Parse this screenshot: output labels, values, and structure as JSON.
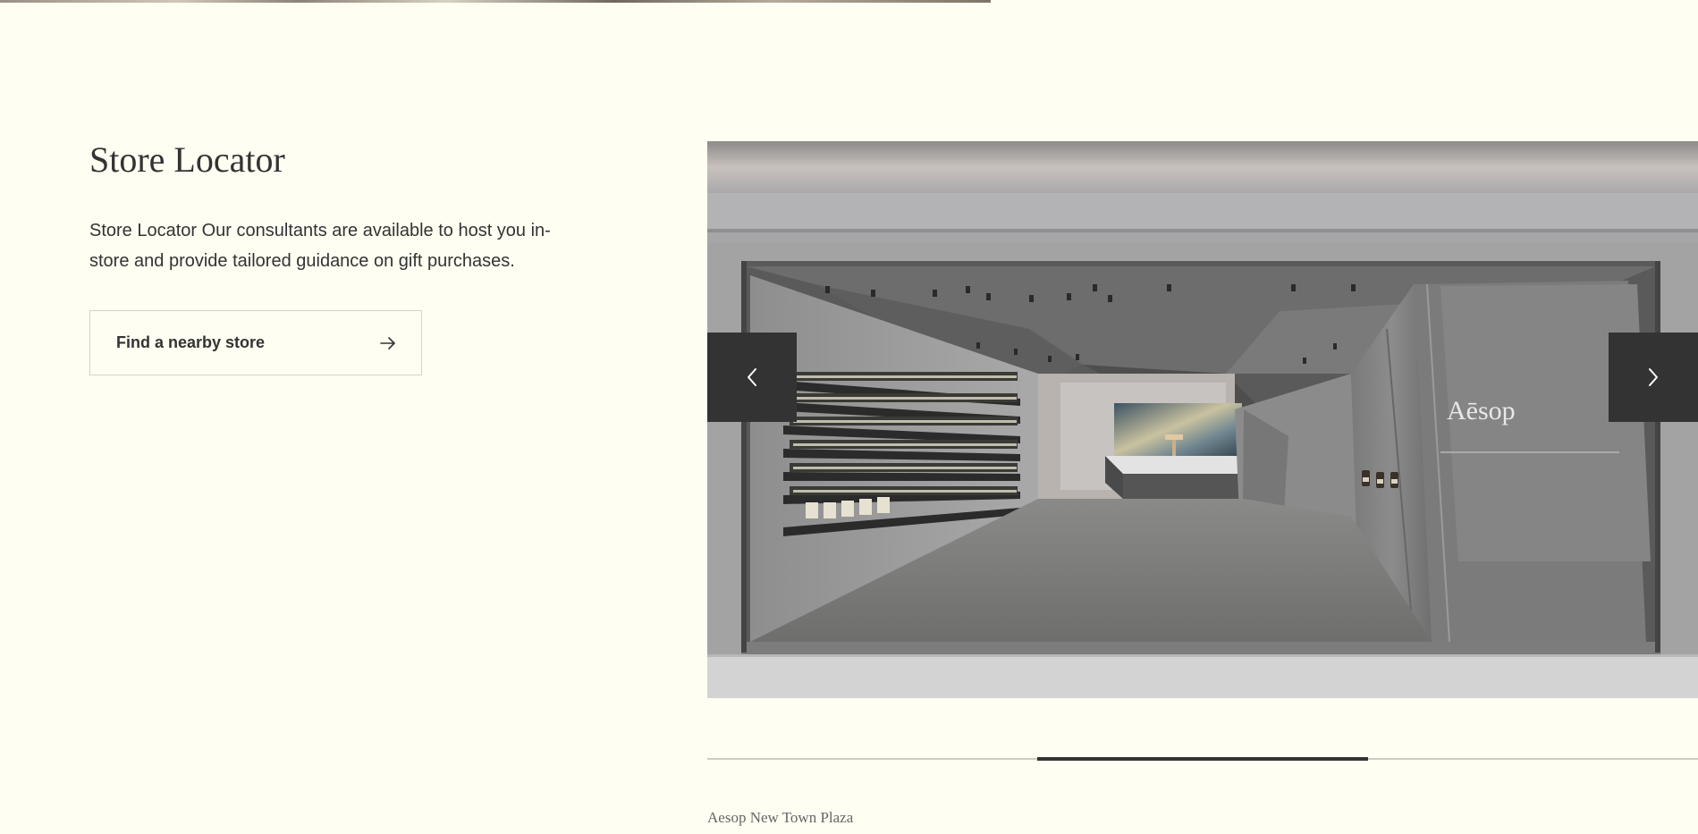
{
  "section": {
    "title": "Store Locator",
    "description": "Store Locator Our consultants are available to host you in-store and provide tailored guidance on gift purchases.",
    "cta_label": "Find a nearby store",
    "cta_icon": "arrow-right-icon"
  },
  "carousel": {
    "slide_brand_text": "Aēsop",
    "caption": "Aesop New Town Plaza",
    "prev_icon": "chevron-left-icon",
    "next_icon": "chevron-right-icon",
    "current_slide": 2,
    "total_slides": 3
  },
  "colors": {
    "page_background": "#fffef2",
    "text": "#333333",
    "button_dark": "#333333",
    "caption_text": "#666666"
  }
}
